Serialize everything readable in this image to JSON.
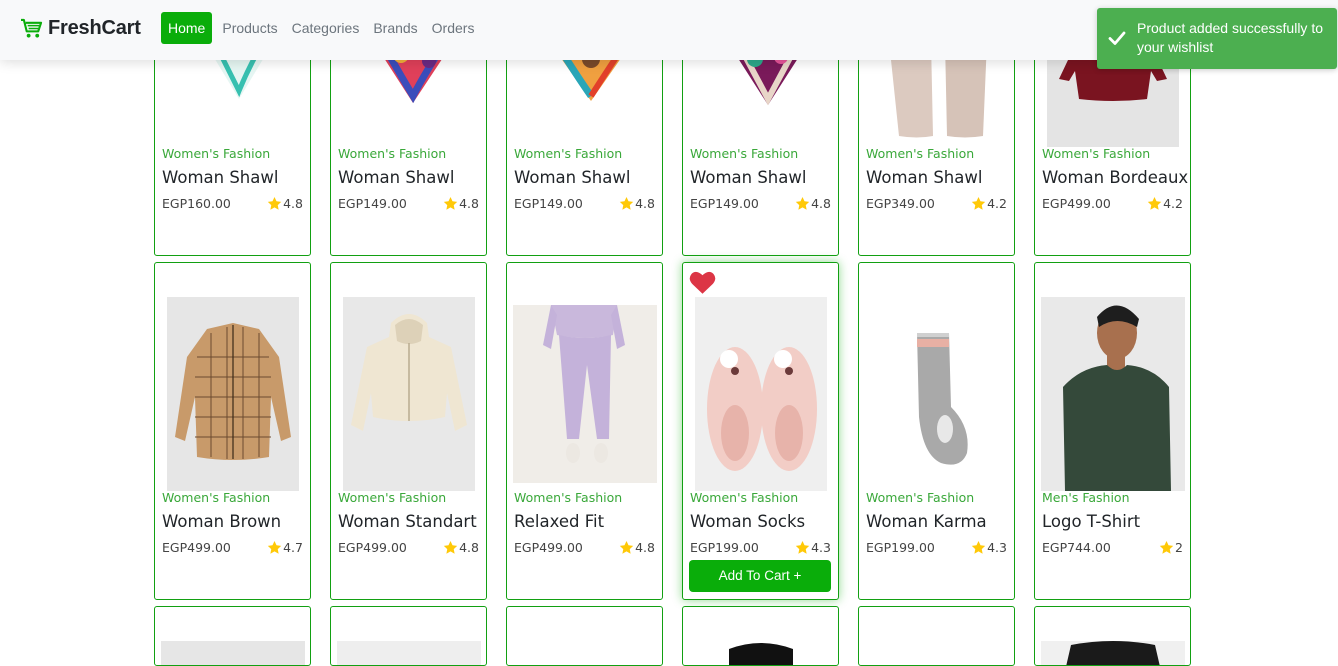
{
  "brand": {
    "name": "FreshCart"
  },
  "nav": {
    "items": [
      "Home",
      "Products",
      "Categories",
      "Brands",
      "Orders"
    ],
    "active": "Home"
  },
  "toast": {
    "message": "Product added successfully to your wishlist",
    "color": "#4caf50"
  },
  "colors": {
    "accent": "#0aad0a",
    "category": "#3aa83a",
    "star": "#ffc908",
    "heart": "#dc3545"
  },
  "currency": "EGP",
  "products_row1": [
    {
      "category": "Women's Fashion",
      "title": "Woman Shawl",
      "price": "EGP160.00",
      "rating": "4.8"
    },
    {
      "category": "Women's Fashion",
      "title": "Woman Shawl",
      "price": "EGP149.00",
      "rating": "4.8"
    },
    {
      "category": "Women's Fashion",
      "title": "Woman Shawl",
      "price": "EGP149.00",
      "rating": "4.8"
    },
    {
      "category": "Women's Fashion",
      "title": "Woman Shawl",
      "price": "EGP149.00",
      "rating": "4.8"
    },
    {
      "category": "Women's Fashion",
      "title": "Woman Shawl",
      "price": "EGP349.00",
      "rating": "4.2"
    },
    {
      "category": "Women's Fashion",
      "title": "Woman Bordeaux",
      "price": "EGP499.00",
      "rating": "4.2"
    }
  ],
  "products_row2": [
    {
      "category": "Women's Fashion",
      "title": "Woman Brown",
      "price": "EGP499.00",
      "rating": "4.7"
    },
    {
      "category": "Women's Fashion",
      "title": "Woman Standart",
      "price": "EGP499.00",
      "rating": "4.8"
    },
    {
      "category": "Women's Fashion",
      "title": "Relaxed Fit",
      "price": "EGP499.00",
      "rating": "4.8"
    },
    {
      "category": "Women's Fashion",
      "title": "Woman Socks",
      "price": "EGP199.00",
      "rating": "4.3",
      "wishlisted": true,
      "hovered": true,
      "button": "Add To Cart +"
    },
    {
      "category": "Women's Fashion",
      "title": "Woman Karma",
      "price": "EGP199.00",
      "rating": "4.3"
    },
    {
      "category": "Men's Fashion",
      "title": "Logo T-Shirt",
      "price": "EGP744.00",
      "rating": "2"
    }
  ]
}
